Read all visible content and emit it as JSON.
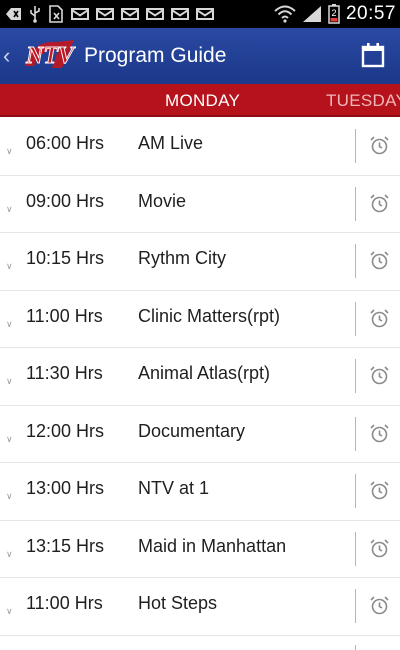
{
  "status_bar": {
    "time": "20:57",
    "battery_level": "2"
  },
  "header": {
    "title": "Program Guide",
    "logo_text": "NTV",
    "back_icon": "chevron-left-icon",
    "calendar_icon": "calendar-icon"
  },
  "tabs": {
    "active": "MONDAY",
    "next": "TUESDAY"
  },
  "colors": {
    "action_bar": "#1d3a8e",
    "tab_bar": "#b5121b",
    "text": "#1f1f1f"
  },
  "programs": [
    {
      "time": "06:00 Hrs",
      "name": "AM Live"
    },
    {
      "time": "09:00 Hrs",
      "name": "Movie"
    },
    {
      "time": "10:15 Hrs",
      "name": "Rythm City"
    },
    {
      "time": "11:00 Hrs",
      "name": "Clinic Matters(rpt)"
    },
    {
      "time": "11:30 Hrs",
      "name": "Animal Atlas(rpt)"
    },
    {
      "time": "12:00 Hrs",
      "name": "Documentary"
    },
    {
      "time": "13:00 Hrs",
      "name": "NTV at 1"
    },
    {
      "time": "13:15 Hrs",
      "name": "Maid in Manhattan"
    },
    {
      "time": "11:00 Hrs",
      "name": "Hot Steps"
    }
  ]
}
